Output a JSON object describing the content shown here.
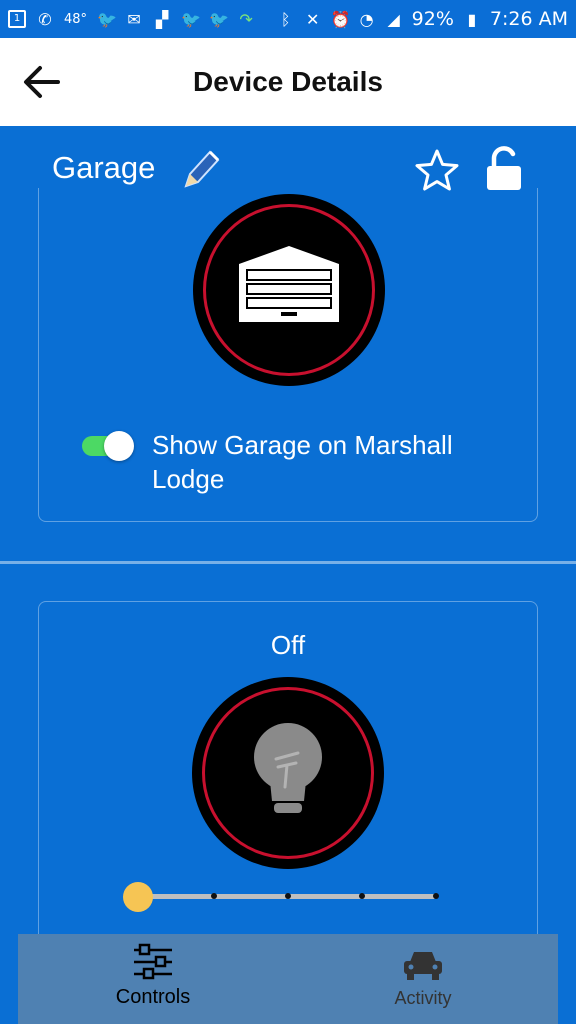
{
  "status_bar": {
    "notification_badge": "1",
    "temperature": "48°",
    "battery": "92%",
    "time": "7:26 AM"
  },
  "app_bar": {
    "title": "Device Details"
  },
  "device": {
    "name": "Garage"
  },
  "garage_card": {
    "toggle_label": "Show Garage on Marshall Lodge",
    "toggle_on": true
  },
  "light_card": {
    "state": "Off",
    "level_fraction": 0.0,
    "level_stops": 5
  },
  "bottom_nav": {
    "tabs": [
      {
        "label": "Controls",
        "active": true
      },
      {
        "label": "Activity",
        "active": false
      }
    ]
  },
  "colors": {
    "background": "#0a6fd4",
    "accent_ring": "#c8102e",
    "toggle_on": "#4cd964",
    "slider_thumb": "#f6c554",
    "bottom_nav": "#4f81b2"
  }
}
